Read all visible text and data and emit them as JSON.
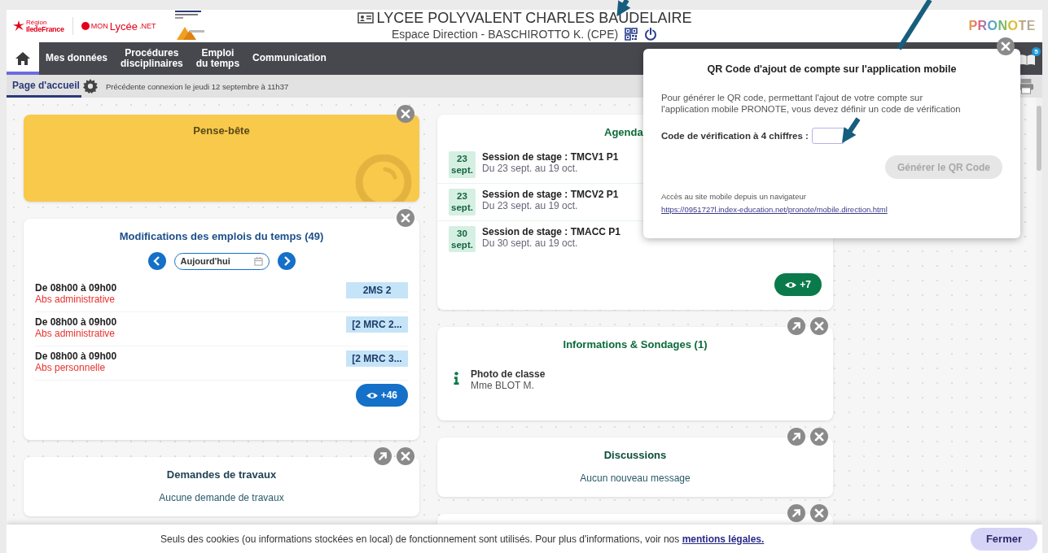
{
  "header": {
    "region_logo": [
      "Région",
      "IledeFrance"
    ],
    "monlycee_logo": [
      "MON",
      "Lycée",
      ".NET"
    ],
    "school": "LYCEE POLYVALENT CHARLES BAUDELAIRE",
    "space": "Espace Direction - BASCHIROTTO K. (CPE)",
    "brand": "PRONOTE"
  },
  "nav": [
    {
      "kind": "home",
      "selected": true
    },
    {
      "kind": "menu",
      "lines": [
        "Mes données"
      ],
      "selected": false
    },
    {
      "kind": "menu",
      "lines": [
        "Procédures",
        "disciplinaires"
      ],
      "selected": false
    },
    {
      "kind": "menu",
      "lines": [
        "Emploi",
        "du temps"
      ],
      "selected": false
    },
    {
      "kind": "menu",
      "lines": [
        "Communication"
      ],
      "selected": false
    }
  ],
  "notifications_badge": "5",
  "subbar": {
    "tab": "Page d'accueil",
    "selected": true,
    "last_login": "Précédente connexion le jeudi 12 septembre à 11h37"
  },
  "columns": [
    [
      {
        "kind": "note",
        "title": "Pense-bête",
        "expandable": false
      },
      {
        "kind": "changes",
        "title": "Modifications des emplois du temps (49)",
        "expandable": false,
        "date": "Aujourd'hui",
        "rows": [
          {
            "time": "De 08h00 à 09h00",
            "reason": "Abs administrative",
            "group": "2MS 2"
          },
          {
            "time": "De 08h00 à 09h00",
            "reason": "Abs administrative",
            "group": "[2 MRC 2..."
          },
          {
            "time": "De 08h00 à 09h00",
            "reason": "Abs personnelle",
            "group": "[2 MRC 3..."
          }
        ],
        "more": "+46"
      },
      {
        "kind": "empty",
        "title": "Demandes de travaux",
        "expandable": true,
        "message": "Aucune demande de travaux"
      }
    ],
    [
      {
        "kind": "agenda",
        "title": "Agenda",
        "expandable": false,
        "closable": false,
        "rows": [
          {
            "day": "23",
            "month": "sept.",
            "title": "Session de stage : TMCV1 P1",
            "range": "Du 23 sept. au 19 oct."
          },
          {
            "day": "23",
            "month": "sept.",
            "title": "Session de stage : TMCV2 P1",
            "range": "Du 23 sept. au 19 oct."
          },
          {
            "day": "30",
            "month": "sept.",
            "title": "Session de stage : TMACC P1",
            "range": "Du 30 sept. au 19 oct."
          }
        ],
        "more": "+7"
      },
      {
        "kind": "info",
        "title": "Informations & Sondages (1)",
        "expandable": true,
        "items": [
          {
            "title": "Photo de classe",
            "author": "Mme BLOT M."
          }
        ]
      },
      {
        "kind": "empty",
        "title": "Discussions",
        "expandable": true,
        "message": "Aucun nouveau message"
      },
      {
        "kind": "blank",
        "expandable": true
      }
    ]
  ],
  "popup": {
    "title": "QR Code d'ajout de compte sur l'application mobile",
    "text": "Pour générer le QR code, permettant l'ajout de votre compte sur l'application mobile PRONOTE, vous devez définir un code de vérification",
    "code_label": "Code de vérification à 4 chiffres :",
    "button": "Générer le QR Code",
    "button_disabled": true,
    "site_label": "Accès au site mobile depuis un navigateur",
    "site_link": "https://0951727l.index-education.net/pronote/mobile.direction.html"
  },
  "cookie": {
    "text": "Seuls des cookies (ou informations stockées en local) de fonctionnement sont utilisés. Pour plus d'informations, voir nos ",
    "link": "mentions légales.",
    "button": "Fermer"
  }
}
